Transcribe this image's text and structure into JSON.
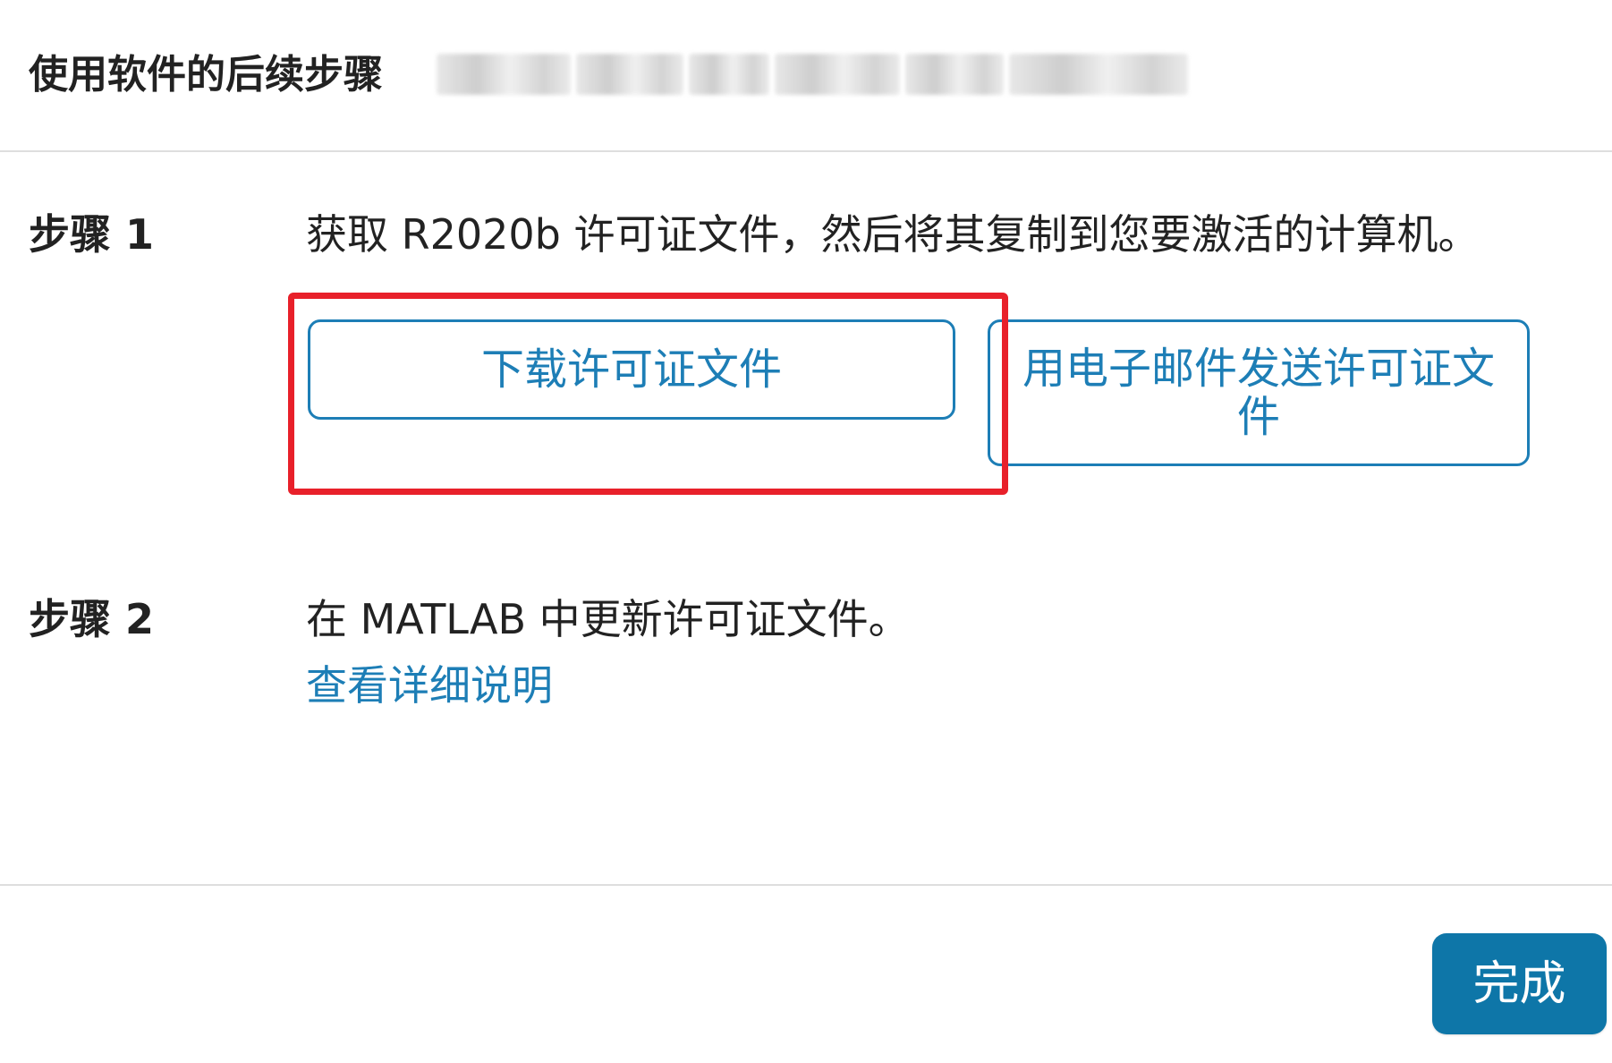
{
  "dialog": {
    "title": "使用软件的后续步骤"
  },
  "step1": {
    "label": "步骤 1",
    "text": "获取 R2020b 许可证文件，然后将其复制到您要激活的计算机。",
    "download_button": "下载许可证文件",
    "email_button": "用电子邮件发送许可证文件"
  },
  "step2": {
    "label": "步骤 2",
    "text": "在 MATLAB 中更新许可证文件。",
    "link": "查看详细说明"
  },
  "footer": {
    "done_button": "完成"
  },
  "colors": {
    "accent": "#1d7eb6",
    "primary_button": "#0e76a8",
    "highlight": "#e8202a"
  }
}
